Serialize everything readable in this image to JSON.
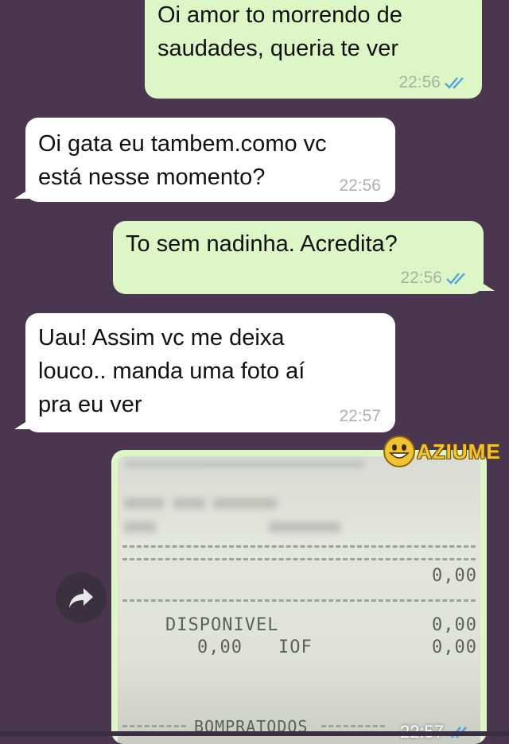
{
  "colors": {
    "background": "#4b3650",
    "outgoing_bubble": "#dcf7c5",
    "incoming_bubble": "#ffffff",
    "read_ticks": "#4fa3e0"
  },
  "messages": [
    {
      "direction": "out",
      "text": "Oi amor to morrendo de\nsaudades, queria te ver",
      "time": "22:56",
      "status_icon": "double-check-read-icon"
    },
    {
      "direction": "in",
      "text": "Oi gata eu tambem.como vc\nestá nesse momento?",
      "time": "22:56"
    },
    {
      "direction": "out",
      "text": "To sem nadinha. Acredita?",
      "time": "22:56",
      "status_icon": "double-check-read-icon"
    },
    {
      "direction": "in",
      "text": "Uau! Assim vc me deixa\nlouco.. manda uma foto aí\npra eu ver",
      "time": "22:57"
    }
  ],
  "image_message": {
    "direction": "out",
    "time": "22:57",
    "status_icon": "double-check-read-icon",
    "receipt": {
      "amount_1": "0,00",
      "label_disponivel": "DISPONIVEL",
      "amount_disponivel": "0,00",
      "amount_left": "0,00",
      "label_iof": "IOF",
      "amount_iof": "0,00",
      "footer": "BOMPRATODOS"
    }
  },
  "forward_button": {
    "icon": "share-forward-icon"
  },
  "watermark": {
    "text": "AZIUME",
    "icon": "grinning-face-icon"
  }
}
